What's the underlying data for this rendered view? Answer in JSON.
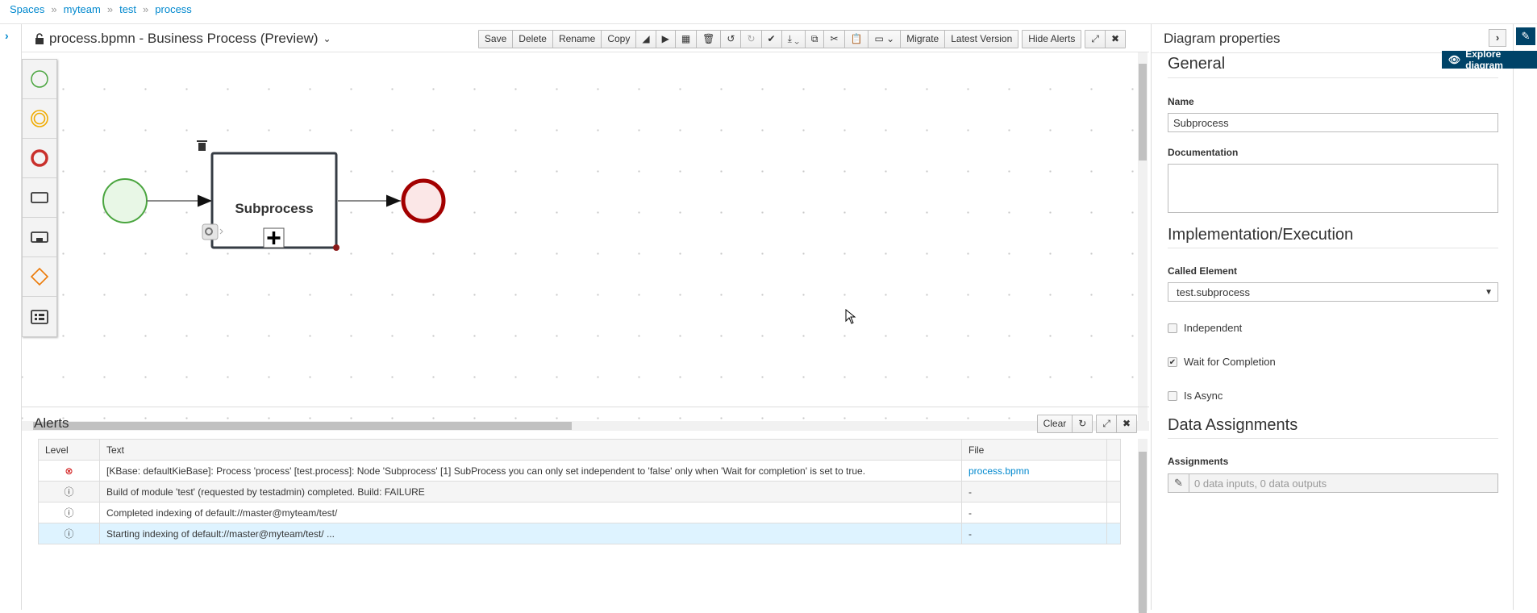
{
  "breadcrumb": [
    "Spaces",
    "myteam",
    "test",
    "process"
  ],
  "breadcrumb_sep": "»",
  "editor": {
    "title": "process.bpmn - Business Process (Preview)",
    "toolbar": {
      "save": "Save",
      "delete": "Delete",
      "rename": "Rename",
      "copy": "Copy",
      "migrate": "Migrate",
      "latest_version": "Latest Version",
      "hide_alerts": "Hide Alerts"
    }
  },
  "diagram": {
    "subprocess_label": "Subprocess"
  },
  "alerts": {
    "title": "Alerts",
    "clear": "Clear",
    "columns": [
      "Level",
      "Text",
      "File"
    ],
    "rows": [
      {
        "level": "error",
        "text": "[KBase: defaultKieBase]: Process 'process' [test.process]: Node 'Subprocess' [1] SubProcess you can only set independent to 'false' only when 'Wait for completion' is set to true.",
        "file": "process.bpmn"
      },
      {
        "level": "info",
        "text": "Build of module 'test' (requested by testadmin) completed. Build: FAILURE",
        "file": "-"
      },
      {
        "level": "info",
        "text": "Completed indexing of default://master@myteam/test/",
        "file": "-"
      },
      {
        "level": "info",
        "text": "Starting indexing of default://master@myteam/test/ ...",
        "file": "-"
      }
    ]
  },
  "properties": {
    "title": "Diagram properties",
    "explore": "Explore diagram",
    "general": "General",
    "name_label": "Name",
    "name_value": "Subprocess",
    "documentation_label": "Documentation",
    "documentation_value": "",
    "implementation": "Implementation/Execution",
    "called_element_label": "Called Element",
    "called_element_value": "test.subprocess",
    "independent": "Independent",
    "independent_checked": false,
    "wait": "Wait for Completion",
    "wait_checked": true,
    "async": "Is Async",
    "async_checked": false,
    "data_assignments": "Data Assignments",
    "assignments_label": "Assignments",
    "assignments_value": "0 data inputs, 0 data outputs"
  },
  "colors": {
    "accent": "#0088ce",
    "dark": "#004368",
    "start": "#4aa53f",
    "end": "#a30000",
    "error": "#cc0000"
  }
}
